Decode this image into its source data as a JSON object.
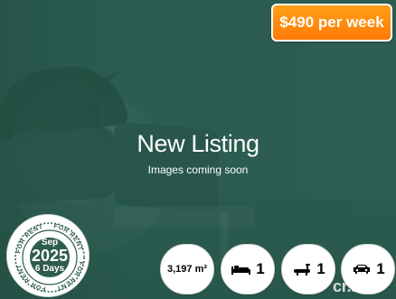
{
  "listing": {
    "headline": "New Listing",
    "subline": "Images coming soon",
    "price_badge": "$490 per week"
  },
  "stamp": {
    "month": "Sep",
    "year": "2025",
    "days": "6 Days",
    "ring_text": "FOR RENT"
  },
  "features": {
    "area": "3,197 m²",
    "bedrooms": "1",
    "bathrooms": "1",
    "car_spaces": "1"
  },
  "brand": {
    "text": "cr.am"
  },
  "colors": {
    "background": "#2f5c4f",
    "price_orange": "#ff8d10",
    "white": "#ffffff"
  },
  "icons": {
    "bedroom": "bed-icon",
    "bathroom": "bath-icon",
    "car": "car-icon"
  }
}
